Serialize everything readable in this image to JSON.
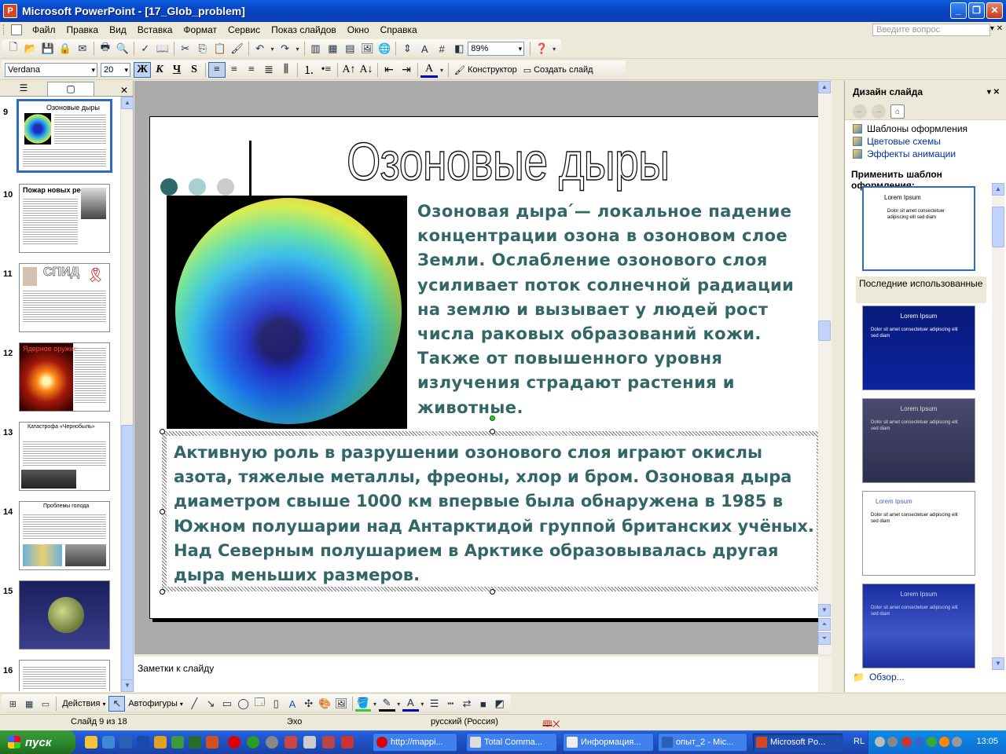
{
  "window": {
    "title": "Microsoft PowerPoint - [17_Glob_problem]",
    "controls": [
      "_",
      "❐",
      "✕"
    ]
  },
  "menu": {
    "items": [
      "Файл",
      "Правка",
      "Вид",
      "Вставка",
      "Формат",
      "Сервис",
      "Показ слайдов",
      "Окно",
      "Справка"
    ],
    "ask_placeholder": "Введите вопрос"
  },
  "toolbar_standard": {
    "zoom": "89%"
  },
  "toolbar_format": {
    "font_name": "Verdana",
    "font_size": "20",
    "bold": "Ж",
    "italic": "К",
    "underline": "Ч",
    "shadow": "S",
    "designer_label": "Конструктор",
    "new_slide_label": "Создать слайд"
  },
  "slides_pane": {
    "thumbnails": [
      {
        "num": "9",
        "title": "Озоновые дыры",
        "selected": true
      },
      {
        "num": "10",
        "title": "Пожар новых ресурсов"
      },
      {
        "num": "11",
        "title": "СПИД"
      },
      {
        "num": "12",
        "title": "Ядерное оружие"
      },
      {
        "num": "13",
        "title": "Катастрофа «Чернобыль»"
      },
      {
        "num": "14",
        "title": "Проблемы голода"
      },
      {
        "num": "15",
        "title": ""
      },
      {
        "num": "16",
        "title": ""
      }
    ]
  },
  "slide": {
    "title": "Озоновые дыры",
    "paragraph1": " Озоновая дыра ́— локальное падение концентрации озона в озоновом слое Земли. Ослабление озонового слоя усиливает поток солнечной радиации на землю и вызывает у людей рост числа раковых образований кожи. Также от повышенного уровня излучения страдают растения и животные.",
    "paragraph2": "Активную роль в разрушении озонового слоя играют окислы азота, тяжелые металлы, фреоны, хлор и бром. Озоновая дыра диаметром свыше 1000 км впервые была обнаружена в 1985 в Южном полушарии над Антарктидой группой британских учёных. Над Северным полушарием в Арктике образовывалась другая дыра меньших размеров.",
    "dot_colors": [
      "#2f6a6a",
      "#a8cfd2",
      "#cccccc"
    ],
    "text_color": "#336666"
  },
  "notes": {
    "placeholder": "Заметки к слайду"
  },
  "task_pane": {
    "title": "Дизайн слайда",
    "links": [
      "Шаблоны оформления",
      "Цветовые схемы",
      "Эффекты анимации"
    ],
    "apply_label": "Применить шаблон оформления:",
    "recent_label": "Последние использованные",
    "template_title": "Lorem Ipsum",
    "template_body": "Dolor sit amet consectetuer adipiscing elit sed diam",
    "browse_label": "Обзор..."
  },
  "drawing_toolbar": {
    "actions_label": "Действия",
    "autoshapes_label": "Автофигуры"
  },
  "status_bar": {
    "slide_info": "Слайд 9 из 18",
    "design": "Эхо",
    "language": "русский (Россия)"
  },
  "taskbar": {
    "start_label": "пуск",
    "tasks": [
      "http://mappi...",
      "Total Comma...",
      "Информация...",
      "опыт_2 - Mic...",
      "Microsoft Po..."
    ],
    "lang": "RL",
    "clock": "13:05"
  }
}
